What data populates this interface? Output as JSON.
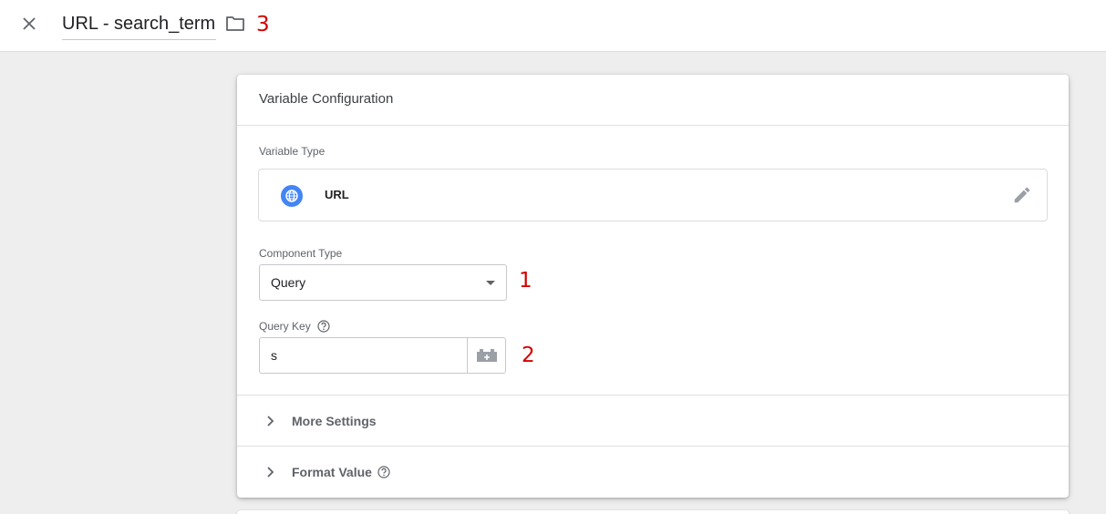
{
  "header": {
    "title": "URL - search_term"
  },
  "annotations": [
    "1",
    "2",
    "3"
  ],
  "card": {
    "title": "Variable Configuration",
    "variable_type": {
      "label": "Variable Type",
      "value": "URL",
      "icon": "globe-icon"
    },
    "component_type": {
      "label": "Component Type",
      "value": "Query"
    },
    "query_key": {
      "label": "Query Key",
      "value": "s",
      "icon": "variable-picker-icon"
    },
    "sections": [
      {
        "label": "More Settings"
      },
      {
        "label": "Format Value"
      }
    ]
  },
  "colors": {
    "accent_blue": "#4285f4",
    "annotation_red": "#d40000",
    "icon_gray": "#5f6368"
  }
}
